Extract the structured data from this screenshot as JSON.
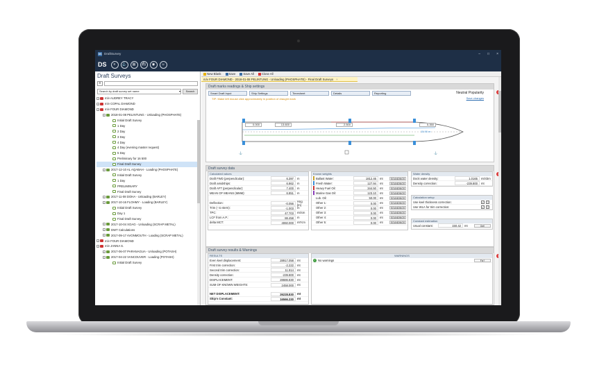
{
  "window": {
    "title": "DraftSurvey",
    "app_short": "DS",
    "online_mode": "Online mode"
  },
  "left_panel": {
    "title": "Draft Surveys",
    "search_by": "Search by draft survey set name",
    "search_button": "Search",
    "tree": [
      {
        "level": 0,
        "icon": "ship",
        "text": "m/v AUDREY TRACY"
      },
      {
        "level": 0,
        "icon": "ship",
        "text": "m/v COPAL DIAMOND"
      },
      {
        "level": 0,
        "icon": "ship",
        "text": "m/v FOUR DIAMOND"
      },
      {
        "level": 1,
        "icon": "port",
        "text": "2018-01-08 PELINTUNG - Unloading (PHOSPHATE)"
      },
      {
        "level": 2,
        "icon": "doc",
        "text": "Initial Draft Survey"
      },
      {
        "level": 2,
        "icon": "doc",
        "text": "1 Day"
      },
      {
        "level": 2,
        "icon": "doc",
        "text": "2 Day"
      },
      {
        "level": 2,
        "icon": "doc",
        "text": "3 Day"
      },
      {
        "level": 2,
        "icon": "doc",
        "text": "4 Day"
      },
      {
        "level": 2,
        "icon": "doc",
        "text": "4 Day (evening master request)"
      },
      {
        "level": 2,
        "icon": "doc",
        "text": "5 Day"
      },
      {
        "level": 2,
        "icon": "doc",
        "text": "Preliminary for 16 500"
      },
      {
        "level": 2,
        "icon": "doc",
        "text": "Final Draft Survey",
        "selected": true
      },
      {
        "level": 1,
        "icon": "port",
        "text": "2017-12-10 AL AQABAH - Loading (PHOSPHATE)"
      },
      {
        "level": 2,
        "icon": "doc",
        "text": "Initial Draft Survey"
      },
      {
        "level": 2,
        "icon": "doc",
        "text": "1 Day"
      },
      {
        "level": 2,
        "icon": "doc",
        "text": "PRELIMINARY"
      },
      {
        "level": 2,
        "icon": "doc",
        "text": "Final Draft Survey"
      },
      {
        "level": 1,
        "icon": "port",
        "text": "2017-11-08 DOHA - Unloading (BARLEY)"
      },
      {
        "level": 1,
        "icon": "port",
        "text": "2017-10-16 FLOHMY - Loading (BARLEY)"
      },
      {
        "level": 2,
        "icon": "doc",
        "text": "Initial Draft Survey"
      },
      {
        "level": 2,
        "icon": "doc",
        "text": "Day 1"
      },
      {
        "level": 2,
        "icon": "doc",
        "text": "Final Draft Survey"
      },
      {
        "level": 1,
        "icon": "port",
        "text": "2017-10-04 XOAG - Unloading (SCRAP METAL)"
      },
      {
        "level": 1,
        "icon": "port",
        "text": "DWT Calculations"
      },
      {
        "level": 1,
        "icon": "port",
        "text": "2017-09-17 AVONMOUTH - Loading (SCRAP METAL)"
      },
      {
        "level": 0,
        "icon": "ship",
        "text": "m/v FOUR DIAMOND"
      },
      {
        "level": 0,
        "icon": "ship",
        "text": "m/v JANNA S."
      },
      {
        "level": 1,
        "icon": "port",
        "text": "2017-06-07 PARANAGUA - Unloading (POTASH)"
      },
      {
        "level": 1,
        "icon": "port",
        "text": "2017-04-22 VANCOUVER - Loading (POTASH)"
      },
      {
        "level": 2,
        "icon": "doc",
        "text": "Initial Draft Survey"
      }
    ]
  },
  "toolbar": {
    "new_blank": "New Blank",
    "save": "Save",
    "save_all": "Save All",
    "close_all": "Close All"
  },
  "doc_tab": "m/v FOUR DIAMOND - 2018-01-08 PELINTUNG - Unloading (PHOSPHATE) - Final Draft Surveys",
  "draft_marks": {
    "title": "Draft marks readings & Ship settings",
    "nav": [
      "Smart Draft Input",
      "Ship Settings",
      "Timesheet",
      "Details",
      "Reporting"
    ],
    "hint": "TIP: Make left mouse click approximately in position of draught mark",
    "neutral": "Neutral Popularity",
    "save_changes": "Save changes",
    "readings": {
      "aft": "0.000",
      "mid_p": "13.600",
      "mid_s": "2.500",
      "fwd": "5.350"
    },
    "dims": {
      "fwd_dim": "15.90 m"
    }
  },
  "draft_data": {
    "title": "Draft survey data",
    "calculated_title": "Calculated values",
    "calculated": [
      {
        "l": "Draft FWD (perpendicular):",
        "v": "6.397",
        "u": "m"
      },
      {
        "l": "Draft amidships:",
        "v": "6.862",
        "u": "m"
      },
      {
        "l": "Draft AFT (perpendicular):",
        "v": "7.400",
        "u": "m"
      },
      {
        "l": "MEAN OF MEANS (MMM):",
        "v": "6.851",
        "u": "m"
      },
      {
        "l": "",
        "v": "",
        "u": ""
      },
      {
        "l": "Deflection:",
        "v": "-0.056",
        "u": "Hog [m]"
      },
      {
        "l": "Trim (- to stern):",
        "v": "-1.003",
        "u": "m"
      },
      {
        "l": "TPC:",
        "v": "47.703",
        "u": "mt/cm"
      },
      {
        "l": "LCF from A.P.:",
        "v": "88.458",
        "u": "m"
      },
      {
        "l": "delta MCT:",
        "v": "4060.000",
        "u": "mt*cm"
      }
    ],
    "known_title": "Known weights",
    "known": [
      {
        "l": "Ballast Water:",
        "v": "1812.46",
        "u": "mt",
        "c": "#c9a227"
      },
      {
        "l": "Fresh Water:",
        "v": "127.94",
        "u": "mt",
        "c": "#3a8fd9"
      },
      {
        "l": "Heavy Fuel Oil:",
        "v": "344.50",
        "u": "mt",
        "c": "#c33"
      },
      {
        "l": "Marine Gas Oil:",
        "v": "123.10",
        "u": "mt",
        "c": "#8a3ab9"
      },
      {
        "l": "Lub. Oil:",
        "v": "50.00",
        "u": "mt",
        "c": ""
      },
      {
        "l": "Other 1:",
        "v": "0.00",
        "u": "mt",
        "c": ""
      },
      {
        "l": "Other 2:",
        "v": "0.00",
        "u": "mt",
        "c": ""
      },
      {
        "l": "Other 3:",
        "v": "0.00",
        "u": "mt",
        "c": ""
      },
      {
        "l": "Other 4:",
        "v": "0.00",
        "u": "mt",
        "c": ""
      },
      {
        "l": "Other 5:",
        "v": "0.00",
        "u": "mt",
        "c": ""
      }
    ],
    "sounding_label": "SOUNDINGS",
    "water_title": "Water density",
    "dock_label": "Dock water density:",
    "dock_value": "1.0165",
    "dock_unit": "mt/cbm",
    "density_corr_label": "Density correction:",
    "density_corr_value": "-239.800",
    "density_corr_unit": "mt",
    "calc_setup_title": "Calculation setup",
    "keel_label": "Use keel thickness correction:",
    "wla_label": "Use WLA for trim correction:",
    "constant_title": "Constant estimation",
    "usual_label": "Usual constant:",
    "usual_value": "150.42",
    "usual_unit": "mt",
    "get_btn": "Get!"
  },
  "results": {
    "title": "Draft survey results & Warnings",
    "results_title": "RESULTS",
    "rows": [
      {
        "l": "Even keel displacement:",
        "v": "28917.058",
        "u": "mt"
      },
      {
        "l": "First trim correction:",
        "v": "-2.222",
        "u": "mt"
      },
      {
        "l": "Second trim correction:",
        "v": "11.914",
        "u": "mt"
      },
      {
        "l": "Density correction:",
        "v": "-239.800",
        "u": "mt"
      },
      {
        "l": "DISPLACEMENT:",
        "v": "28686.830",
        "u": "mt"
      },
      {
        "l": "SUM OF KNOWN WEIGHTS:",
        "v": "2458.000",
        "u": "mt"
      }
    ],
    "net_label": "NET DISPLACEMENT:",
    "net_value": "26228.830",
    "net_unit": "mt",
    "const_label": "Ship's Constant:",
    "const_value": "16566.330",
    "const_unit": "mt",
    "warnings_title": "WARNINGS",
    "no_warnings": "No warnings",
    "fix": "Fix?"
  }
}
